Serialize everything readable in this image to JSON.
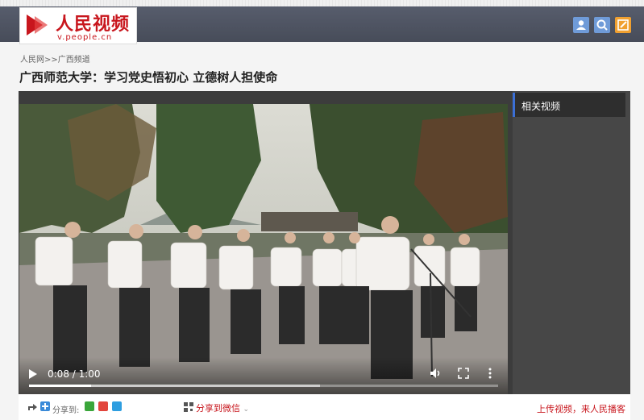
{
  "header": {
    "logo_text": "人民视频",
    "logo_url": "v.people.cn",
    "icons": [
      "user-icon",
      "search-icon",
      "edit-icon"
    ],
    "icon_colors": {
      "user": "#6f9bd8",
      "search": "#6f9bd8",
      "edit": "#f0a030"
    }
  },
  "breadcrumb": {
    "home": "人民网",
    "sep": ">>",
    "channel": "广西频道"
  },
  "article": {
    "title": "广西师范大学：学习党史悟初心 立德树人担使命"
  },
  "player": {
    "current_time": "0:08",
    "duration": "1:00",
    "time_display": "0:08 / 1:00",
    "progress_fraction": 0.133,
    "buffered_fraction": 0.62
  },
  "sidebar": {
    "heading": "相关视频"
  },
  "share": {
    "label": "分享到:",
    "wechat_label": "分享到微信",
    "upload_text": "上传视频，来人民播客"
  },
  "colors": {
    "brand_red": "#c8161d",
    "accent_blue": "#3b6fd6"
  }
}
